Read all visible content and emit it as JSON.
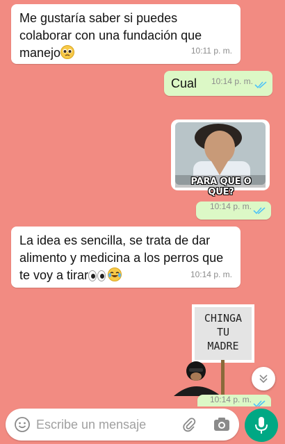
{
  "messages": [
    {
      "id": "m1",
      "direction": "incoming",
      "text_lines": [
        "Me gustaría saber si puedes",
        "colaborar con una fundación que",
        "manejo"
      ],
      "emoji": "pleading-face",
      "time": "10:11 p. m."
    },
    {
      "id": "m2",
      "direction": "outgoing",
      "text": "Cual",
      "time": "10:14 p. m.",
      "status": "read"
    },
    {
      "id": "m3",
      "direction": "outgoing",
      "type": "sticker",
      "sticker_caption": "PARA QUE O QUE?",
      "time": "10:14 p. m.",
      "status": "read"
    },
    {
      "id": "m4",
      "direction": "incoming",
      "text_lines": [
        "La idea es sencilla, se trata de dar",
        "alimento y medicina a los perros que",
        "te voy a tirar"
      ],
      "emoji": "eyes-joy",
      "time": "10:14 p. m."
    },
    {
      "id": "m5",
      "direction": "outgoing",
      "type": "sticker",
      "sticker_sign_lines": [
        "CHINGA",
        "TU",
        "MADRE"
      ],
      "time": "10:14 p. m.",
      "status": "read"
    }
  ],
  "composer": {
    "placeholder": "Escribe un mensaje"
  },
  "icons": {
    "emoji": "emoji-icon",
    "attach": "paperclip-icon",
    "camera": "camera-icon",
    "mic": "microphone-icon",
    "scroll": "chevron-double-down-icon"
  },
  "colors": {
    "wallpaper": "#f28b82",
    "incoming_bubble": "#ffffff",
    "outgoing_bubble": "#dcf8c6",
    "read_ticks": "#4fc3f7",
    "mic_button": "#00a884"
  }
}
